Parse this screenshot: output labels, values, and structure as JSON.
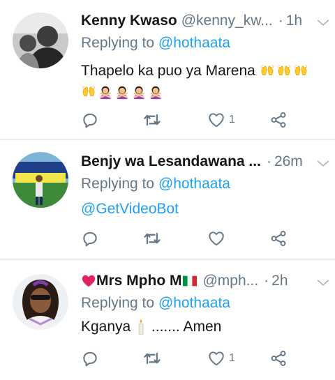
{
  "replies": [
    {
      "name": "Kenny Kwaso",
      "handle": "@kenny_kw...",
      "separator": "·",
      "time": "1h",
      "replying_prefix": "Replying to",
      "replying_to": "@hothaata",
      "text": "Thapelo ka puo ya Marena",
      "emoji_line1": [
        "raised-hands",
        "raised-hands",
        "raised-hands"
      ],
      "emoji_line2": [
        "raised-hands",
        "person-gesturing-no",
        "person-gesturing-no",
        "person-gesturing-no",
        "person-gesturing-no"
      ],
      "like_count": "1"
    },
    {
      "name": "Benjy wa Lesandawana ...",
      "separator": "·",
      "time": "26m",
      "replying_prefix": "Replying to",
      "replying_to": "@hothaata",
      "text": "@GetVideoBot",
      "like_count": ""
    },
    {
      "name_prefix_emoji": "red-heart",
      "name": "Mrs Mpho M",
      "name_suffix_emoji": "flag-italy",
      "handle": "@mph...",
      "separator": "·",
      "time": "2h",
      "replying_prefix": "Replying to",
      "replying_to": "@hothaata",
      "text_before": "Kganya",
      "text_emoji": "candle",
      "text_after": "....... Amen",
      "like_count": "1"
    }
  ],
  "icons": [
    "reply-icon",
    "retweet-icon",
    "like-icon",
    "share-icon",
    "chevron-down-icon"
  ],
  "colors": {
    "text": "#14171a",
    "secondary": "#657786",
    "link": "#1da1f2",
    "divider": "#e6ecf0"
  }
}
